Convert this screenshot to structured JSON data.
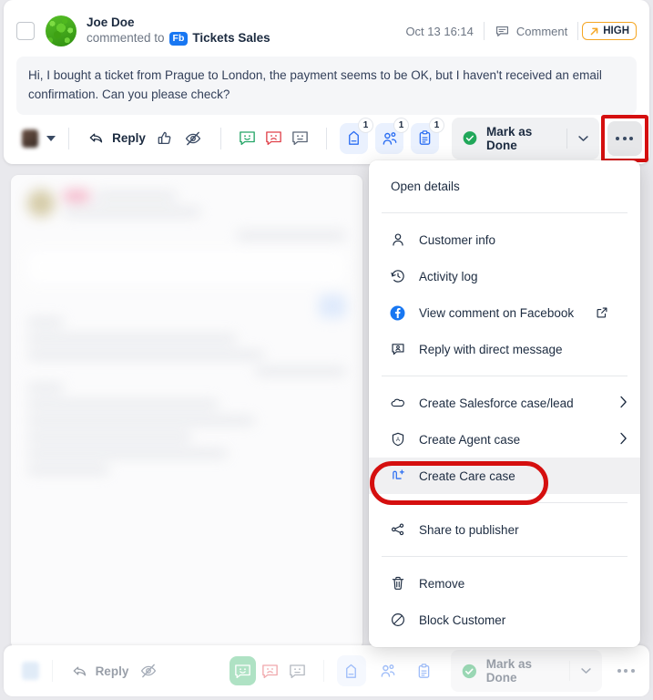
{
  "header": {
    "user_name": "Joe Doe",
    "action_text": "commented to",
    "channel_badge": "Fb",
    "conversation_name": "Tickets Sales",
    "timestamp": "Oct 13 16:14",
    "type_label": "Comment",
    "priority_label": "HIGH",
    "priority_color": "#f5a623",
    "checkbox_name": "select-conversation-checkbox"
  },
  "message": {
    "text": "Hi, I bought a ticket from Prague to London, the payment seems to be OK, but I haven't received an email confirmation. Can you please check?"
  },
  "toolbar": {
    "reply_label": "Reply",
    "done_label": "Mark as Done",
    "tag_count": "1",
    "assignee_count": "1",
    "note_count": "1",
    "done_check_color": "#21a85a"
  },
  "menu": {
    "open_details": "Open details",
    "items": [
      {
        "label": "Customer info",
        "icon": "person-icon"
      },
      {
        "label": "Activity log",
        "icon": "history-clock-icon"
      },
      {
        "label": "View comment on Facebook",
        "icon": "facebook-icon",
        "external": true
      },
      {
        "label": "Reply with direct message",
        "icon": "direct-message-icon"
      }
    ],
    "case_items": [
      {
        "label": "Create Salesforce case/lead",
        "icon": "salesforce-cloud-icon",
        "submenu": true
      },
      {
        "label": "Create Agent case",
        "icon": "agent-shield-icon",
        "submenu": true
      },
      {
        "label": "Create Care case",
        "icon": "care-case-icon",
        "highlighted": true
      }
    ],
    "share_label": "Share to publisher",
    "destructive": [
      {
        "label": "Remove",
        "icon": "trash-icon"
      },
      {
        "label": "Block Customer",
        "icon": "block-icon"
      }
    ]
  },
  "bottom_bar": {
    "reply_label": "Reply",
    "done_label": "Mark as Done"
  },
  "colors": {
    "accent_blue": "#2b6ef2",
    "positive": "#23a566",
    "negative": "#e0414a",
    "neutral": "#5b6677",
    "annotation_red": "#d50f0f"
  }
}
